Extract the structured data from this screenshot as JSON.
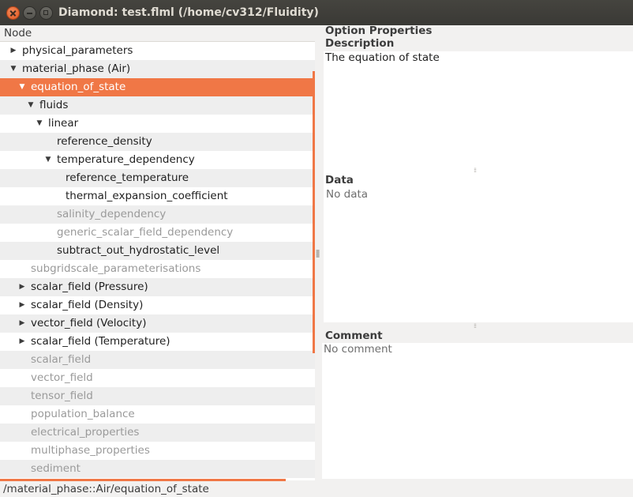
{
  "window": {
    "title": "Diamond: test.flml (/home/cv312/Fluidity)"
  },
  "tree": {
    "header": "Node",
    "rows": [
      {
        "label": "physical_parameters",
        "arrow": "right",
        "depth": 1,
        "state": "normal"
      },
      {
        "label": "material_phase (Air)",
        "arrow": "down",
        "depth": 1,
        "state": "normal"
      },
      {
        "label": "equation_of_state",
        "arrow": "down",
        "depth": 2,
        "state": "selected"
      },
      {
        "label": "fluids",
        "arrow": "down",
        "depth": 3,
        "state": "normal"
      },
      {
        "label": "linear",
        "arrow": "down",
        "depth": 4,
        "state": "normal"
      },
      {
        "label": "reference_density",
        "arrow": "",
        "depth": 5,
        "state": "normal"
      },
      {
        "label": "temperature_dependency",
        "arrow": "down",
        "depth": 5,
        "state": "normal"
      },
      {
        "label": "reference_temperature",
        "arrow": "",
        "depth": 6,
        "state": "normal"
      },
      {
        "label": "thermal_expansion_coefficient",
        "arrow": "",
        "depth": 6,
        "state": "normal"
      },
      {
        "label": "salinity_dependency",
        "arrow": "",
        "depth": 5,
        "state": "disabled"
      },
      {
        "label": "generic_scalar_field_dependency",
        "arrow": "",
        "depth": 5,
        "state": "disabled"
      },
      {
        "label": "subtract_out_hydrostatic_level",
        "arrow": "",
        "depth": 5,
        "state": "normal"
      },
      {
        "label": "subgridscale_parameterisations",
        "arrow": "",
        "depth": 2,
        "state": "disabled"
      },
      {
        "label": "scalar_field (Pressure)",
        "arrow": "right",
        "depth": 2,
        "state": "normal"
      },
      {
        "label": "scalar_field (Density)",
        "arrow": "right",
        "depth": 2,
        "state": "normal"
      },
      {
        "label": "vector_field (Velocity)",
        "arrow": "right",
        "depth": 2,
        "state": "normal"
      },
      {
        "label": "scalar_field (Temperature)",
        "arrow": "right",
        "depth": 2,
        "state": "normal"
      },
      {
        "label": "scalar_field",
        "arrow": "",
        "depth": 2,
        "state": "disabled"
      },
      {
        "label": "vector_field",
        "arrow": "",
        "depth": 2,
        "state": "disabled"
      },
      {
        "label": "tensor_field",
        "arrow": "",
        "depth": 2,
        "state": "disabled"
      },
      {
        "label": "population_balance",
        "arrow": "",
        "depth": 2,
        "state": "disabled"
      },
      {
        "label": "electrical_properties",
        "arrow": "",
        "depth": 2,
        "state": "disabled"
      },
      {
        "label": "multiphase_properties",
        "arrow": "",
        "depth": 2,
        "state": "disabled"
      },
      {
        "label": "sediment",
        "arrow": "",
        "depth": 2,
        "state": "disabled"
      }
    ]
  },
  "properties": {
    "heading": "Option Properties",
    "description_title": "Description",
    "description_text": "The equation of state",
    "data_title": "Data",
    "data_text": "No data",
    "comment_title": "Comment",
    "comment_text": "No comment"
  },
  "status": {
    "path": "/material_phase::Air/equation_of_state"
  },
  "colors": {
    "selection": "#f07746",
    "titlebar": "#3c3b37"
  }
}
